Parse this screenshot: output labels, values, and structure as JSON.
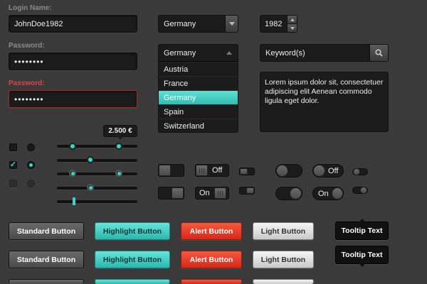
{
  "login": {
    "name_label": "Login Name:",
    "name_value": "JohnDoe1982",
    "password_label": "Password:",
    "password_value": "••••••••",
    "password_error_label": "Password:",
    "password_error_value": "••••••••"
  },
  "country_select": {
    "value": "Germany"
  },
  "year_stepper": {
    "value": "1982"
  },
  "country_dropdown": {
    "selected": "Germany",
    "options": [
      "Austria",
      "France",
      "Germany",
      "Spain",
      "Switzerland"
    ]
  },
  "search": {
    "placeholder": "Keyword(s)"
  },
  "textarea": {
    "text": "Lorem ipsum dolor sit, consectetuer adipiscing elit Aenean commodo ligula eget dolor."
  },
  "slider": {
    "value_label": "2.500 €"
  },
  "toggles": {
    "off_label": "Off",
    "on_label": "On",
    "pill_off_label": "Off",
    "pill_on_label": "On"
  },
  "buttons": {
    "standard": "Standard Button",
    "highlight": "Highlight Button",
    "alert": "Alert Button",
    "light": "Light Button"
  },
  "tooltips": {
    "top": "Tooltip Text",
    "bottom": "Tooltip Text"
  },
  "colors": {
    "accent": "#3cd3c8",
    "alert": "#e03a26",
    "background": "#3a3a3a"
  }
}
